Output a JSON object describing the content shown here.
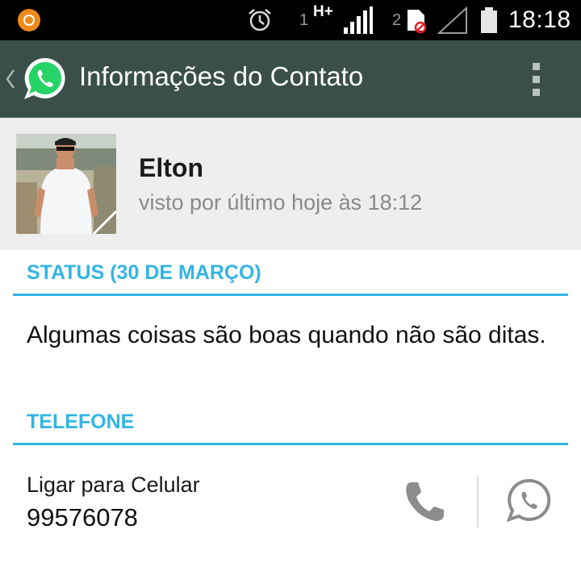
{
  "status_bar": {
    "sim1_label": "1",
    "network_type": "H+",
    "sim2_label": "2",
    "time": "18:18",
    "icons": [
      "notification-icon",
      "alarm-icon",
      "signal-icon",
      "sim-card-icon",
      "battery-icon"
    ]
  },
  "action_bar": {
    "title": "Informações do Contato",
    "icons": [
      "back-chevron-icon",
      "whatsapp-logo-icon",
      "overflow-menu-icon"
    ]
  },
  "contact": {
    "name": "Elton",
    "last_seen": "visto por último hoje às 18:12"
  },
  "status_section": {
    "header": "STATUS (30 DE MARÇO)",
    "text": "Algumas coisas são boas quando não são ditas."
  },
  "phone_section": {
    "header": "TELEFONE",
    "label": "Ligar para Celular",
    "number": "99576078",
    "actions": [
      "phone-call-icon",
      "whatsapp-message-icon"
    ]
  },
  "colors": {
    "action_bar": "#3b4f4a",
    "accent": "#33b5e5",
    "profile_bg": "#eeeeee",
    "whatsapp_green": "#25d366"
  }
}
